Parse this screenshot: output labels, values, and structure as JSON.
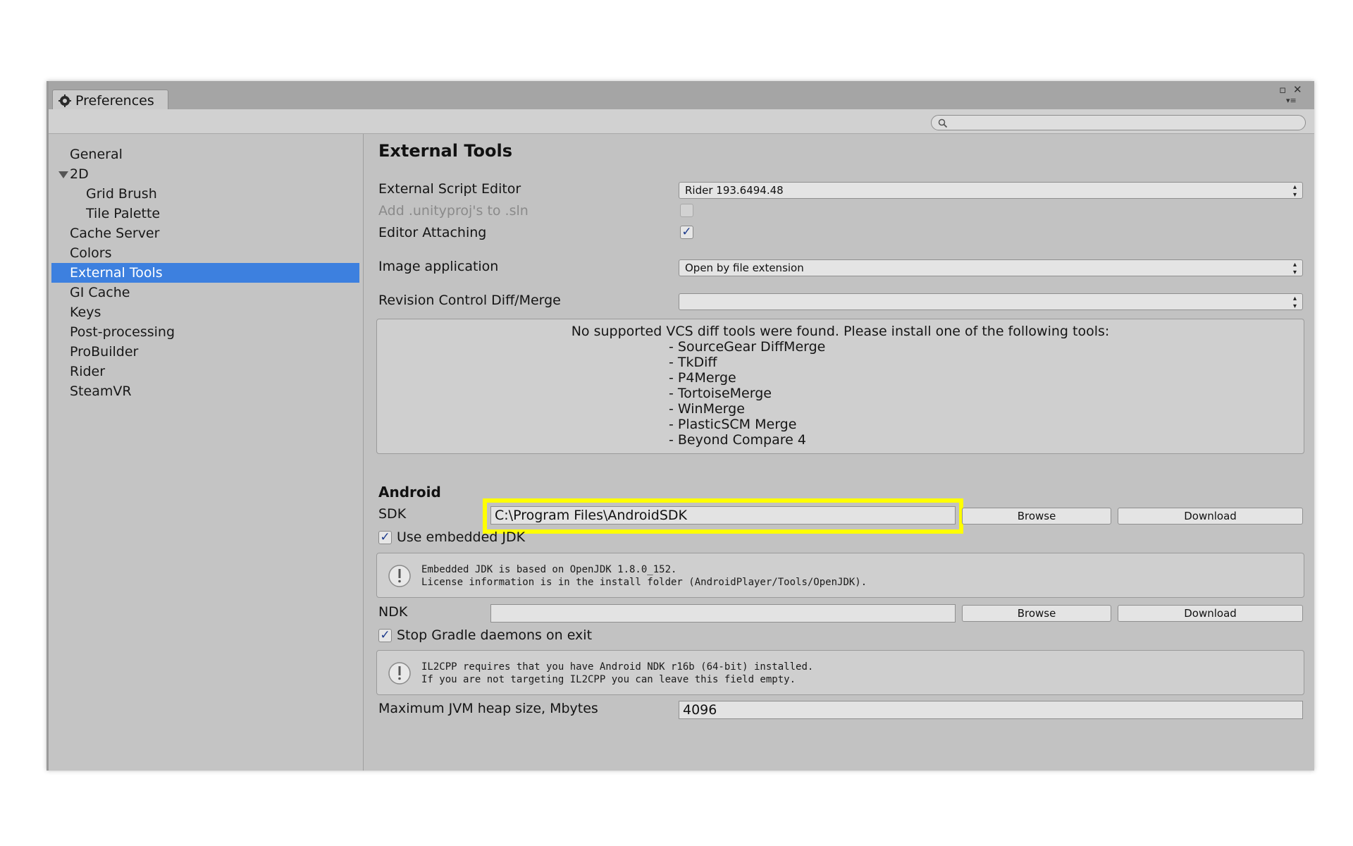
{
  "window": {
    "tab_title": "Preferences",
    "controls": {
      "maximize": "▫",
      "close": "✕",
      "menu": "▾≡"
    },
    "search": {
      "placeholder": "",
      "icon": "search-icon"
    }
  },
  "sidebar": {
    "items": [
      {
        "label": "General",
        "indent": 0,
        "selected": false
      },
      {
        "label": "2D",
        "indent": 0,
        "selected": false,
        "expanded": true
      },
      {
        "label": "Grid Brush",
        "indent": 1,
        "selected": false
      },
      {
        "label": "Tile Palette",
        "indent": 1,
        "selected": false
      },
      {
        "label": "Cache Server",
        "indent": 0,
        "selected": false
      },
      {
        "label": "Colors",
        "indent": 0,
        "selected": false
      },
      {
        "label": "External Tools",
        "indent": 0,
        "selected": true
      },
      {
        "label": "GI Cache",
        "indent": 0,
        "selected": false
      },
      {
        "label": "Keys",
        "indent": 0,
        "selected": false
      },
      {
        "label": "Post-processing",
        "indent": 0,
        "selected": false
      },
      {
        "label": "ProBuilder",
        "indent": 0,
        "selected": false
      },
      {
        "label": "Rider",
        "indent": 0,
        "selected": false
      },
      {
        "label": "SteamVR",
        "indent": 0,
        "selected": false
      }
    ],
    "selected_color": "#3d80df"
  },
  "main": {
    "title": "External Tools",
    "script_editor": {
      "label": "External Script Editor",
      "value": "Rider 193.6494.48"
    },
    "unityproj": {
      "label": "Add .unityproj's to .sln",
      "checked": false,
      "enabled": false
    },
    "editor_attaching": {
      "label": "Editor Attaching",
      "checked": true
    },
    "image_app": {
      "label": "Image application",
      "value": "Open by file extension"
    },
    "revision_control": {
      "label": "Revision Control Diff/Merge",
      "value": ""
    },
    "vcs_message": {
      "intro": "No supported VCS diff tools were found. Please install one of the following tools:",
      "tools": [
        "- SourceGear DiffMerge",
        "- TkDiff",
        "- P4Merge",
        "- TortoiseMerge",
        "- WinMerge",
        "- PlasticSCM Merge",
        "- Beyond Compare 4"
      ]
    },
    "android": {
      "heading": "Android",
      "sdk": {
        "label": "SDK",
        "value": "C:\\Program Files\\AndroidSDK",
        "browse": "Browse",
        "download": "Download"
      },
      "embedded_jdk": {
        "label": "Use embedded JDK",
        "checked": true
      },
      "jdk_info": {
        "line1": "Embedded JDK is based on OpenJDK 1.8.0_152.",
        "line2": "License information is in the install folder (AndroidPlayer/Tools/OpenJDK)."
      },
      "ndk": {
        "label": "NDK",
        "value": "",
        "browse": "Browse",
        "download": "Download"
      },
      "stop_gradle": {
        "label": "Stop Gradle daemons on exit",
        "checked": true
      },
      "il2cpp_info": {
        "line1": "IL2CPP requires that you have Android NDK r16b (64-bit) installed.",
        "line2": "If you are not targeting IL2CPP you can leave this field empty."
      },
      "jvm_heap": {
        "label": "Maximum JVM heap size, Mbytes",
        "value": "4096"
      }
    },
    "highlight_color": "#ffff00"
  }
}
